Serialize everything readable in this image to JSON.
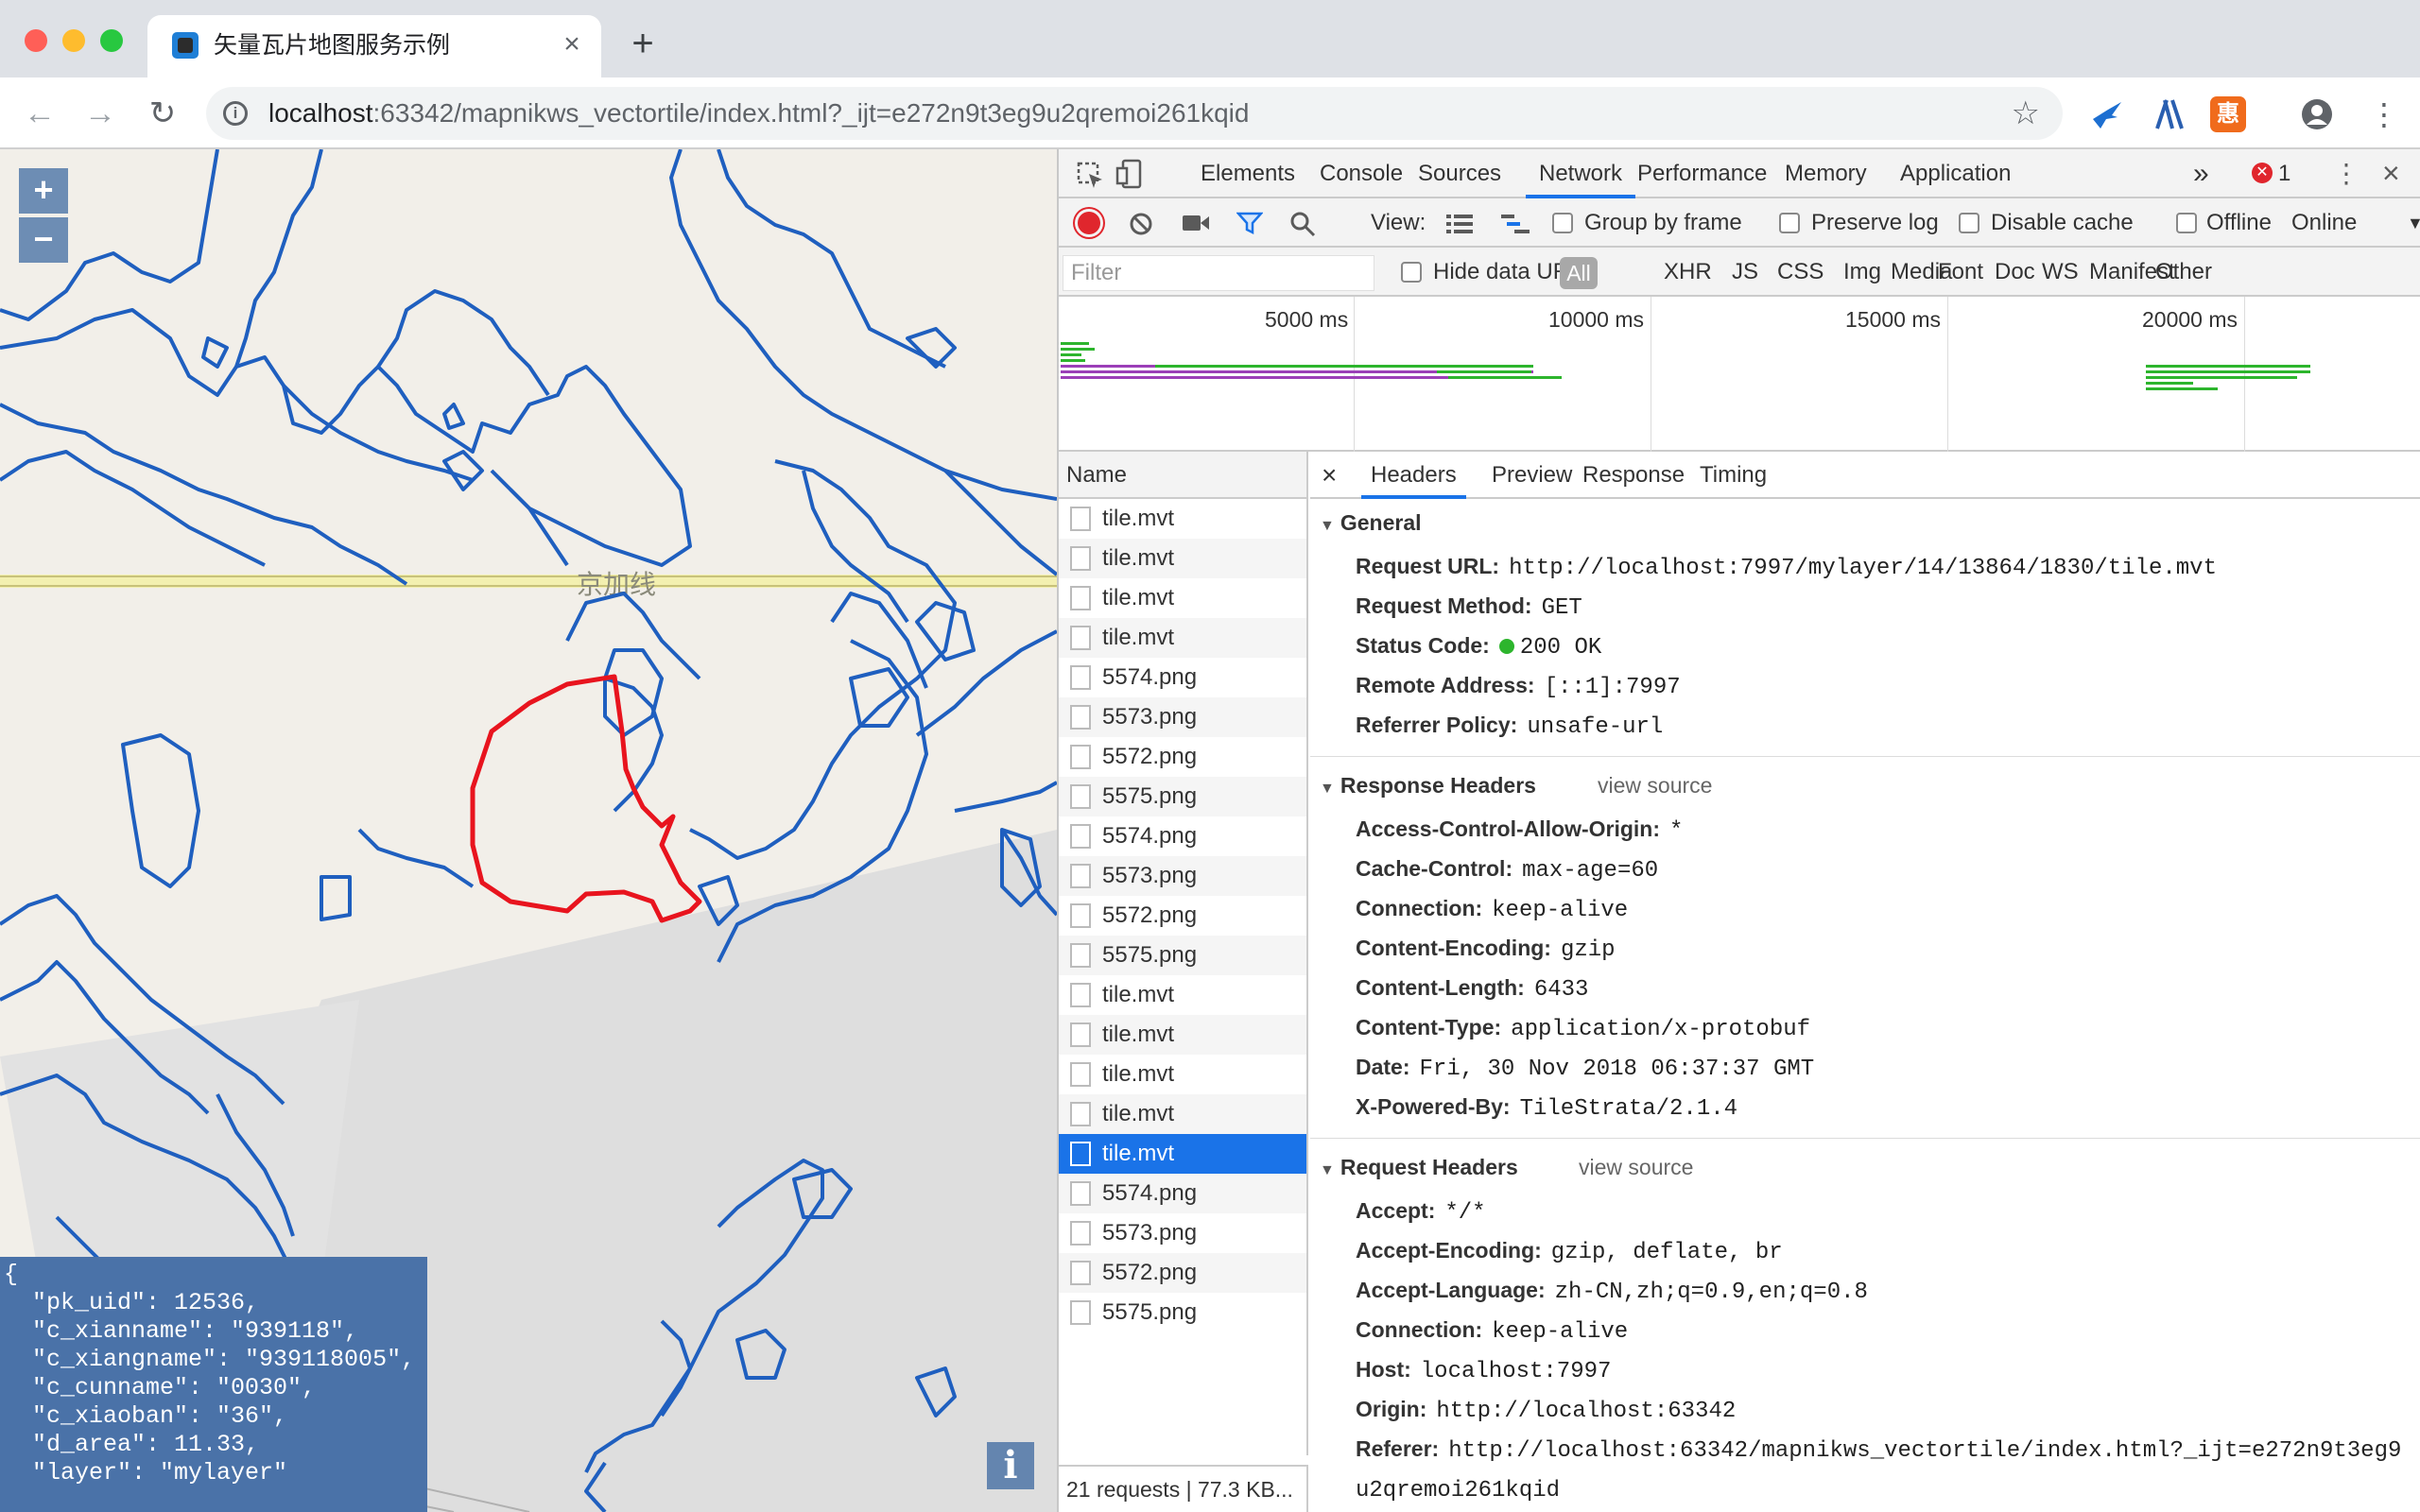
{
  "browser": {
    "tab_title": "矢量瓦片地图服务示例",
    "tab_close": "×",
    "new_tab": "+",
    "url_host": "localhost",
    "url_rest": ":63342/mapnikws_vectortile/index.html?_ijt=e272n9t3eg9u2qremoi261kqid"
  },
  "map": {
    "zoom_in": "+",
    "zoom_out": "−",
    "info_button": "i",
    "rail_label": "京加线",
    "popup": {
      "open": "{",
      "lines": [
        "  \"pk_uid\": 12536,",
        "  \"c_xianname\": \"939118\",",
        "  \"c_xiangname\": \"939118005\",",
        "  \"c_cunname\": \"0030\",",
        "  \"c_xiaoban\": \"36\",",
        "  \"d_area\": 11.33,",
        "  \"layer\": \"mylayer\""
      ]
    }
  },
  "devtools": {
    "tabs": [
      "Elements",
      "Console",
      "Sources",
      "Network",
      "Performance",
      "Memory",
      "Application"
    ],
    "active_tab": "Network",
    "more": "»",
    "error_count": "1",
    "toolbar": {
      "view_label": "View:",
      "group_by_frame": "Group by frame",
      "preserve_log": "Preserve log",
      "disable_cache": "Disable cache",
      "offline": "Offline",
      "throttle": "Online"
    },
    "filter": {
      "placeholder": "Filter",
      "hide_data_urls": "Hide data URLs",
      "all": "All",
      "types": [
        "XHR",
        "JS",
        "CSS",
        "Img",
        "Media",
        "Font",
        "Doc",
        "WS",
        "Manifest",
        "Other"
      ]
    },
    "overview_ticks": [
      "5000 ms",
      "10000 ms",
      "15000 ms",
      "20000 ms"
    ],
    "list": {
      "header": "Name",
      "items": [
        "tile.mvt",
        "tile.mvt",
        "tile.mvt",
        "tile.mvt",
        "5574.png",
        "5573.png",
        "5572.png",
        "5575.png",
        "5574.png",
        "5573.png",
        "5572.png",
        "5575.png",
        "tile.mvt",
        "tile.mvt",
        "tile.mvt",
        "tile.mvt",
        "tile.mvt",
        "5574.png",
        "5573.png",
        "5572.png",
        "5575.png"
      ],
      "selected_index": 16,
      "status": "21 requests | 77.3 KB..."
    },
    "detail_tabs": [
      "Headers",
      "Preview",
      "Response",
      "Timing"
    ],
    "detail_close": "×",
    "active_detail_tab": "Headers",
    "general": {
      "title": "General",
      "items": [
        {
          "k": "Request URL:",
          "v": "http://localhost:7997/mylayer/14/13864/1830/tile.mvt"
        },
        {
          "k": "Request Method:",
          "v": "GET"
        },
        {
          "k": "Status Code:",
          "v": "200 OK"
        },
        {
          "k": "Remote Address:",
          "v": "[::1]:7997"
        },
        {
          "k": "Referrer Policy:",
          "v": "unsafe-url"
        }
      ]
    },
    "response_headers": {
      "title": "Response Headers",
      "view_source": "view source",
      "items": [
        {
          "k": "Access-Control-Allow-Origin:",
          "v": "*"
        },
        {
          "k": "Cache-Control:",
          "v": "max-age=60"
        },
        {
          "k": "Connection:",
          "v": "keep-alive"
        },
        {
          "k": "Content-Encoding:",
          "v": "gzip"
        },
        {
          "k": "Content-Length:",
          "v": "6433"
        },
        {
          "k": "Content-Type:",
          "v": "application/x-protobuf"
        },
        {
          "k": "Date:",
          "v": "Fri, 30 Nov 2018 06:37:37 GMT"
        },
        {
          "k": "X-Powered-By:",
          "v": "TileStrata/2.1.4"
        }
      ]
    },
    "request_headers": {
      "title": "Request Headers",
      "view_source": "view source",
      "items": [
        {
          "k": "Accept:",
          "v": "*/*"
        },
        {
          "k": "Accept-Encoding:",
          "v": "gzip, deflate, br"
        },
        {
          "k": "Accept-Language:",
          "v": "zh-CN,zh;q=0.9,en;q=0.8"
        },
        {
          "k": "Connection:",
          "v": "keep-alive"
        },
        {
          "k": "Host:",
          "v": "localhost:7997"
        },
        {
          "k": "Origin:",
          "v": "http://localhost:63342"
        },
        {
          "k": "Referer:",
          "v": "http://localhost:63342/mapnikws_vectortile/index.html?_ijt=e272n9t3eg9"
        },
        {
          "k": "",
          "v": "u2qremoi261kqid"
        }
      ]
    }
  },
  "colors": {
    "feature_stroke": "#1f5fbf",
    "selected_feature": "#e8141e",
    "active_blue": "#1a73e8",
    "popup_bg": "#4a72a8"
  }
}
